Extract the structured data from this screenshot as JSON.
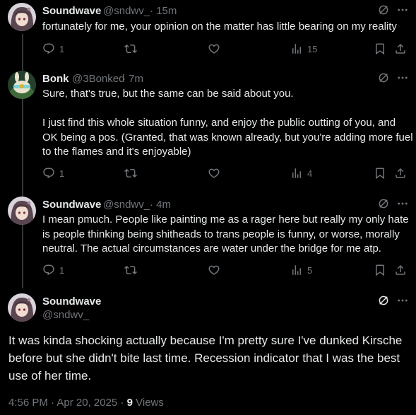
{
  "tweets": [
    {
      "name": "Soundwave",
      "handle": "@sndwv_",
      "time": "· 15m",
      "text": "fortunately for me, your opinion on the matter has little bearing on my reality",
      "replies": "1",
      "views": "15"
    },
    {
      "name": "Bonk",
      "handle": "@3Bonked",
      "time": "· 7m",
      "text_lines": [
        "Sure, that's true, but the same can be said about you.",
        "",
        "I just find this whole situation funny, and enjoy the public outting of you, and OK being a pos. (Granted, that was known already, but you're adding more fuel to the flames and it's enjoyable)"
      ],
      "replies": "1",
      "views": "4"
    },
    {
      "name": "Soundwave",
      "handle": "@sndwv_",
      "time": "· 4m",
      "text": "I mean pmuch. People like painting me as a rager here but really my only hate is people thinking being shitheads to trans people is funny, or worse, morally neutral. The actual circumstances are water under the bridge for me atp.",
      "replies": "1",
      "views": "5"
    }
  ],
  "main_tweet": {
    "name": "Soundwave",
    "handle": "@sndwv_",
    "text": "It was kinda shocking actually because I'm pretty sure I've dunked Kirsche before but she didn't bite last time. Recession indicator that I was the best use of her time.",
    "timestamp": "4:56 PM · Apr 20, 2025 ·",
    "views_count": "9",
    "views_label": "Views"
  },
  "icons": {
    "reply": "reply-icon",
    "retweet": "retweet-icon",
    "like": "heart-icon",
    "views": "views-chart-icon",
    "bookmark": "bookmark-icon",
    "share": "share-icon",
    "grok": "grok-icon",
    "more": "more-icon"
  },
  "colors": {
    "background": "#000000",
    "text": "#e7e9ea",
    "muted": "#71767b",
    "line": "#333639"
  }
}
